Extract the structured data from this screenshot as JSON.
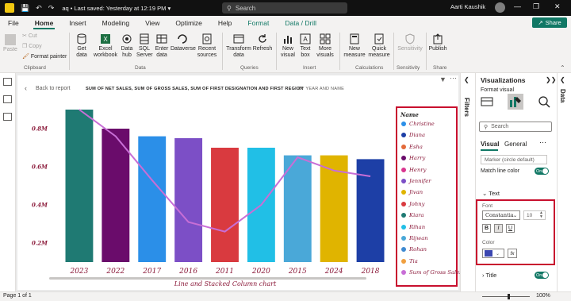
{
  "titlebar": {
    "doc_name": "aq",
    "saved_text": "Last saved: Yesterday at 12:19 PM",
    "search_label": "Search",
    "user_name": "Aarti Kaushik"
  },
  "menu": {
    "tabs": [
      "File",
      "Home",
      "Insert",
      "Modeling",
      "View",
      "Optimize",
      "Help",
      "Format",
      "Data / Drill"
    ],
    "share_label": "Share"
  },
  "ribbon": {
    "items": [
      {
        "label": "Paste",
        "disabled": true
      },
      {
        "label": "Cut",
        "disabled": true
      },
      {
        "label": "Copy",
        "disabled": true
      },
      {
        "label": "Format painter",
        "disabled": false
      },
      {
        "label": "Get data",
        "disabled": false
      },
      {
        "label": "Excel workbook",
        "disabled": false
      },
      {
        "label": "Data hub",
        "disabled": false
      },
      {
        "label": "SQL Server",
        "disabled": false
      },
      {
        "label": "Enter data",
        "disabled": false
      },
      {
        "label": "Dataverse",
        "disabled": false
      },
      {
        "label": "Recent sources",
        "disabled": false
      },
      {
        "label": "Transform data",
        "disabled": false
      },
      {
        "label": "Refresh",
        "disabled": false
      },
      {
        "label": "New visual",
        "disabled": false
      },
      {
        "label": "Text box",
        "disabled": false
      },
      {
        "label": "More visuals",
        "disabled": false
      },
      {
        "label": "New measure",
        "disabled": false
      },
      {
        "label": "Quick measure",
        "disabled": false
      },
      {
        "label": "Sensitivity",
        "disabled": true
      },
      {
        "label": "Publish",
        "disabled": false
      }
    ],
    "groups": [
      "Clipboard",
      "Data",
      "Queries",
      "Insert",
      "Calculations",
      "Sensitivity",
      "Share"
    ]
  },
  "visual_header": {
    "back_label": "Back to report",
    "title": "SUM OF NET SALES, SUM OF GROSS SALES, SUM OF FIRST DESIGNATION AND FIRST REGION",
    "subtitle": "BY YEAR AND NAME"
  },
  "chart_data": {
    "type": "bar",
    "categories": [
      "2023",
      "2022",
      "2017",
      "2016",
      "2011",
      "2020",
      "2015",
      "2024",
      "2018"
    ],
    "bar_colors": [
      "#1f7a73",
      "#6a0c6b",
      "#2b8fe8",
      "#7c4fc6",
      "#d93a3f",
      "#21bfe6",
      "#4aa8d8",
      "#e0b400",
      "#1d3fa6"
    ],
    "series": [
      {
        "name": "Net Sales",
        "values": [
          0.9,
          0.8,
          0.76,
          0.75,
          0.7,
          0.7,
          0.66,
          0.66,
          0.64
        ]
      },
      {
        "name": "Sum of Gross Sales",
        "type": "line",
        "color": "#c86ed6",
        "values": [
          0.9,
          0.76,
          0.53,
          0.31,
          0.26,
          0.4,
          0.65,
          0.58,
          0.55
        ]
      }
    ],
    "yticks": [
      "0.2M",
      "0.4M",
      "0.6M",
      "0.8M"
    ],
    "ylim": [
      0.1,
      0.95
    ],
    "xlabel": "Line and Stacked Column chart",
    "legend": {
      "title": "Name",
      "placement": "right",
      "items": [
        {
          "label": "Christine",
          "color": "#2b8fe8"
        },
        {
          "label": "Diana",
          "color": "#1d3fa6"
        },
        {
          "label": "Esha",
          "color": "#e36a3a"
        },
        {
          "label": "Harry",
          "color": "#6a0c6b"
        },
        {
          "label": "Henry",
          "color": "#d9368f"
        },
        {
          "label": "Jennifer",
          "color": "#7c4fc6"
        },
        {
          "label": "Jivan",
          "color": "#e0b400"
        },
        {
          "label": "Johny",
          "color": "#d93a3f"
        },
        {
          "label": "Kiara",
          "color": "#1f7a73"
        },
        {
          "label": "Rihan",
          "color": "#21bfe6"
        },
        {
          "label": "Rijwan",
          "color": "#4aa8d8"
        },
        {
          "label": "Rohan",
          "color": "#3f8ad1"
        },
        {
          "label": "Tia",
          "color": "#f0a040"
        },
        {
          "label": "Sum of Gross Sales",
          "color": "#c86ed6"
        }
      ]
    }
  },
  "filters": {
    "label": "Filters"
  },
  "viz_pane": {
    "title": "Visualizations",
    "subtitle": "Format visual",
    "search_placeholder": "Search",
    "tab_visual": "Visual",
    "tab_general": "General",
    "marker_value": "Marker (circle default)",
    "match_line_label": "Match line color",
    "toggle_on": "On",
    "text_section": "Text",
    "font_label": "Font",
    "font_value": "Constantia",
    "font_size": "10",
    "bold": "B",
    "italic": "I",
    "underline": "U",
    "color_label": "Color",
    "color_value": "#3b46b0",
    "fx_label": "fx",
    "title_section": "Title"
  },
  "data_pane": {
    "label": "Data"
  },
  "status": {
    "page_info": "Page 1 of 1",
    "zoom": "100%"
  }
}
